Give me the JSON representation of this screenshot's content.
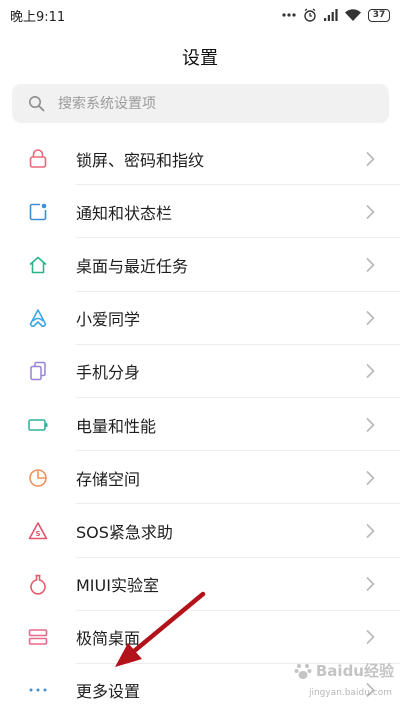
{
  "status_bar": {
    "time": "晚上9:11",
    "battery": "37"
  },
  "header": {
    "title": "设置"
  },
  "search": {
    "placeholder": "搜索系统设置项"
  },
  "items": [
    {
      "label": "锁屏、密码和指纹",
      "icon": "lock-icon",
      "color": "#e86a7a"
    },
    {
      "label": "通知和状态栏",
      "icon": "notification-icon",
      "color": "#3d8fdc"
    },
    {
      "label": "桌面与最近任务",
      "icon": "home-icon",
      "color": "#2bb58b"
    },
    {
      "label": "小爱同学",
      "icon": "xiaoai-icon",
      "color": "#3aa6e8"
    },
    {
      "label": "手机分身",
      "icon": "second-space-icon",
      "color": "#9b82d6"
    },
    {
      "label": "电量和性能",
      "icon": "battery-icon",
      "color": "#2fb39a"
    },
    {
      "label": "存储空间",
      "icon": "storage-icon",
      "color": "#f0935e"
    },
    {
      "label": "SOS紧急求助",
      "icon": "sos-icon",
      "color": "#e2546b"
    },
    {
      "label": "MIUI实验室",
      "icon": "lab-icon",
      "color": "#e65b6e"
    },
    {
      "label": "极简桌面",
      "icon": "simple-mode-icon",
      "color": "#e86a8a"
    },
    {
      "label": "更多设置",
      "icon": "more-icon",
      "color": "#3d8fdc"
    }
  ],
  "watermark": {
    "text": "Baidu经验",
    "sub": "jingyan.baidu.com"
  },
  "colors": {
    "accent_arrow": "#b3121a",
    "chevron": "#b8b8b8"
  }
}
